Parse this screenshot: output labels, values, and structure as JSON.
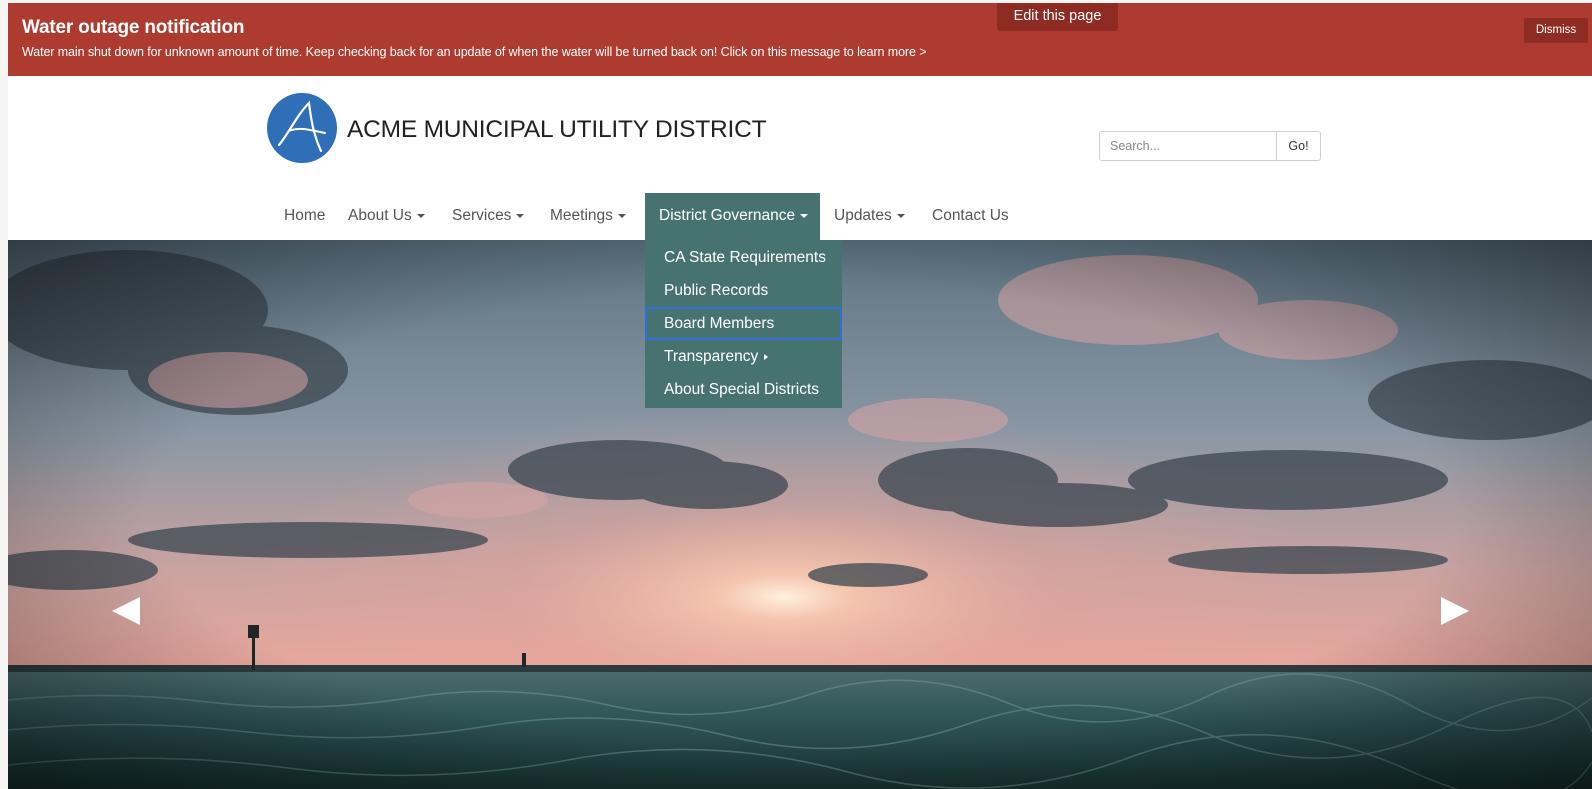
{
  "alert": {
    "title": "Water outage notification",
    "message": "Water main shut down for unknown amount of time. Keep checking back for an update of when the water will be turned back on! Click on this message to learn more >",
    "dismiss_label": "Dismiss",
    "color": "#ad3b2f"
  },
  "edit_page_label": "Edit this page",
  "site": {
    "title": "ACME MUNICIPAL UTILITY DISTRICT",
    "logo_letter": "A",
    "logo_color": "#2e6fb7"
  },
  "search": {
    "placeholder": "Search...",
    "value": "",
    "button_label": "Go!"
  },
  "nav": {
    "accent": "#467370",
    "items": [
      {
        "label": "Home",
        "has_dropdown": false
      },
      {
        "label": "About Us",
        "has_dropdown": true
      },
      {
        "label": "Services",
        "has_dropdown": true
      },
      {
        "label": "Meetings",
        "has_dropdown": true
      },
      {
        "label": "District Governance",
        "has_dropdown": true,
        "active": true
      },
      {
        "label": "Updates",
        "has_dropdown": true
      },
      {
        "label": "Contact Us",
        "has_dropdown": false
      }
    ]
  },
  "dropdown": {
    "items": [
      {
        "label": "CA State Requirements"
      },
      {
        "label": "Public Records"
      },
      {
        "label": "Board Members",
        "focused": true
      },
      {
        "label": "Transparency",
        "submenu": true
      },
      {
        "label": "About Special Districts"
      }
    ]
  },
  "carousel": {
    "prev_icon": "triangle-left-icon",
    "next_icon": "triangle-right-icon"
  }
}
